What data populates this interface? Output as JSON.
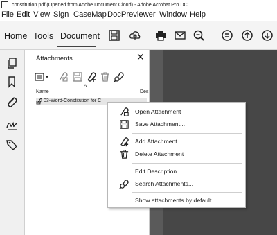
{
  "window": {
    "title": "constitution.pdf (Opened from Adobe Document Cloud) - Adobe Acrobat Pro DC"
  },
  "menubar": {
    "items": [
      "File",
      "Edit",
      "View",
      "Sign",
      "CaseMap",
      "DocPreviewer",
      "Window",
      "Help"
    ]
  },
  "toolbar": {
    "tabs": [
      "Home",
      "Tools",
      "Document"
    ],
    "active_tab": "Document",
    "icons": [
      "save-icon",
      "upload-cloud-icon",
      "print-icon",
      "email-icon",
      "zoom-search-icon",
      "page-nav-icon",
      "up-arrow-icon",
      "down-arrow-icon"
    ]
  },
  "leftrail": {
    "icons": [
      "copy-pages-icon",
      "bookmark-icon",
      "paperclip-icon",
      "signature-icon",
      "tag-icon"
    ]
  },
  "panel": {
    "title": "Attachments",
    "close_glyph": "✕",
    "toolbar_icons": [
      "options-menu-icon",
      "open-attachment-icon",
      "save-attachment-icon",
      "add-attachment-icon",
      "delete-icon",
      "search-attachment-icon"
    ],
    "columns": {
      "name": "Name",
      "description": "Des"
    },
    "rows": [
      {
        "name": "03-Word-Constitution for C"
      }
    ]
  },
  "context_menu": {
    "items": [
      {
        "label": "Open Attachment",
        "icon": "open-attachment-icon"
      },
      {
        "label": "Save Attachment...",
        "icon": "save-attachment-icon"
      },
      {
        "label": "Add Attachment...",
        "icon": "add-attachment-icon"
      },
      {
        "label": "Delete Attachment",
        "icon": "delete-icon"
      },
      {
        "label": "Edit Description...",
        "icon": ""
      },
      {
        "label": "Search Attachments...",
        "icon": "search-attachment-icon"
      },
      {
        "label": "Show attachments by default",
        "icon": ""
      }
    ]
  },
  "colors": {
    "accent": "#444444",
    "doc_background": "#5a5a5a"
  }
}
